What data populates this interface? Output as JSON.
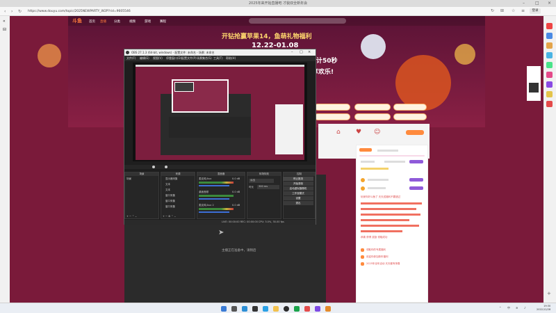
{
  "browser": {
    "tab_title": "2025年来开始直播吧 才貌双全新年会",
    "url": "https://www.douyu.com/topic/2025NEWPARTY_W2P?rid=9605546",
    "login_label": "登录"
  },
  "site": {
    "logo": "斗鱼",
    "nav": [
      "首页",
      "直播",
      "分类",
      "视频",
      "游戏",
      "赛程"
    ],
    "banner_title": "开钻抢赢苹果14，鱼萌礼物福利",
    "banner_date": "12.22-01.08",
    "banner_line1": "倒计50秒",
    "banner_line2": "享欢乐!",
    "side_list": [
      "玩家你好斗鱼了 天天送福利不要错过",
      "恭喜 获得 奖励 领取成功"
    ],
    "side_items": [
      "领取你的专属福利",
      "欢迎你参加新年福利",
      "2025年全年活动 天天都有惊喜"
    ]
  },
  "obs": {
    "title": "OBS 27.1.3 (64-bit, windows) - 配置文件: 未命名 - 场景: 未命名",
    "menu": [
      "文件(F)",
      "编辑(E)",
      "视图(V)",
      "停靠窗口(D)",
      "配置文件(P)",
      "场景集合(S)",
      "工具(T)",
      "帮助(H)"
    ],
    "docks": {
      "scenes": "场景",
      "sources": "来源",
      "mixer": "混音器",
      "transitions": "转场特效",
      "controls": "控制"
    },
    "scene_item": "场景",
    "source_items": [
      "显示器采集",
      "文本",
      "文本",
      "窗口采集",
      "窗口采集",
      "窗口采集"
    ],
    "mixer_tracks": [
      "麦克风/Aux",
      "桌面音频",
      "麦克风/Aux 2"
    ],
    "mixer_db": "0.0 dB",
    "transition_value": "淡出",
    "duration_label": "时长",
    "duration_value": "300 ms",
    "controls": [
      "停止推流",
      "开始录制",
      "启动虚拟摄像机",
      "工作室模式",
      "设置",
      "退出"
    ],
    "status": "LIVE: 00:00:00   REC: 00:00:00   CPU: 3.0%, 30.00 fps"
  },
  "dark_area_text": "主播正在准备中，请稍后",
  "taskbar": {
    "clock_time": "19:30",
    "clock_date": "2022/12/28",
    "tray_lang": "中"
  },
  "colors": {
    "page_bg": "#7a1a3a",
    "accent": "#ff7a3d",
    "obs_bg": "#1e1e1e"
  }
}
